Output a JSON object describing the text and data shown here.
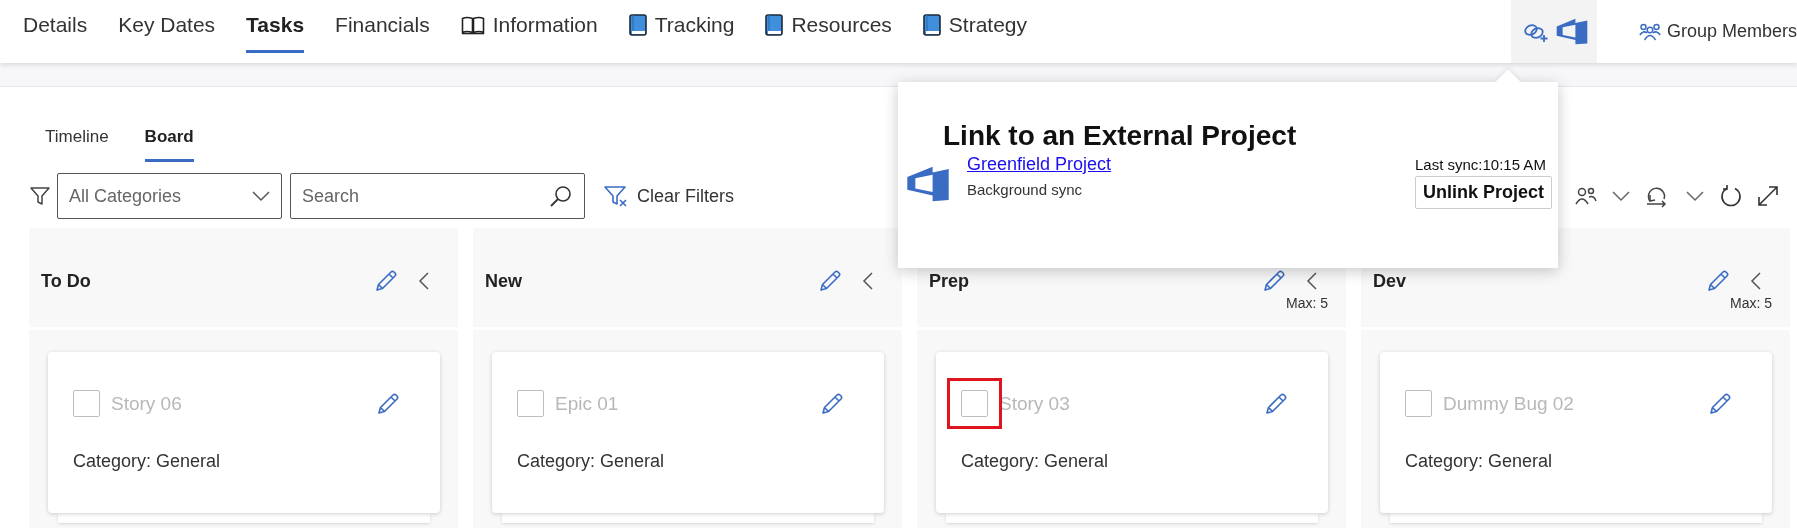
{
  "nav_tabs": [
    {
      "label": "Details",
      "kind": "text",
      "selected": false
    },
    {
      "label": "Key Dates",
      "kind": "text",
      "selected": false
    },
    {
      "label": "Tasks",
      "kind": "text",
      "selected": true
    },
    {
      "label": "Financials",
      "kind": "text",
      "selected": false
    },
    {
      "label": "Information",
      "kind": "open-book",
      "selected": false
    },
    {
      "label": "Tracking",
      "kind": "book",
      "selected": false
    },
    {
      "label": "Resources",
      "kind": "book",
      "selected": false
    },
    {
      "label": "Strategy",
      "kind": "book",
      "selected": false
    }
  ],
  "header_actions": {
    "group_members": "Group Members"
  },
  "view_tabs": [
    {
      "label": "Timeline",
      "selected": false
    },
    {
      "label": "Board",
      "selected": true
    }
  ],
  "filters": {
    "category": {
      "value": "All Categories"
    },
    "search": {
      "placeholder": "Search"
    },
    "clear_button": "Clear Filters"
  },
  "columns": [
    {
      "title": "To Do",
      "cards": [
        {
          "title": "Story 06",
          "category": "Category: General",
          "checked": false,
          "highlighted": false
        }
      ]
    },
    {
      "title": "New",
      "cards": [
        {
          "title": "Epic 01",
          "category": "Category: General",
          "checked": false,
          "highlighted": false
        }
      ]
    },
    {
      "title": "Prep",
      "max": "Max: 5",
      "cards": [
        {
          "title": "Story 03",
          "category": "Category: General",
          "checked": false,
          "highlighted": true
        }
      ]
    },
    {
      "title": "Dev",
      "max": "Max: 5",
      "cards": [
        {
          "title": "Dummy Bug 02",
          "category": "Category: General",
          "checked": false,
          "highlighted": false
        }
      ]
    }
  ],
  "popup": {
    "title": "Link to an External Project",
    "project_link": "Greenfield Project",
    "sync_mode": "Background sync",
    "last_sync": "Last sync:10:15 AM",
    "button": "Unlink Project"
  }
}
